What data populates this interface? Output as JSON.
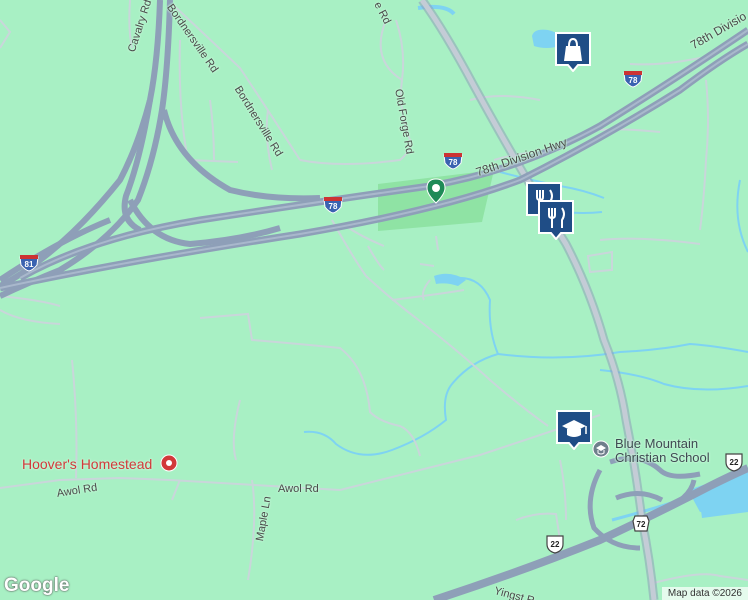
{
  "map": {
    "colors": {
      "land": "#a8f0c4",
      "highway": "#8e9fb8",
      "highway_edge": "#7587a3",
      "minor_road": "#c9d6da",
      "water": "#7ed3f2",
      "park": "#8fe3a4",
      "poi_red": "#d2393a"
    },
    "roads": {
      "cavalry": "Cavalry Rd",
      "bordnersville_top": "Bordnersville Rd",
      "bordnersville_mid": "Bordnersville Rd",
      "old_forge": "Old Forge Rd",
      "road_top_cut": "e Rd",
      "hwy_78th": "78th Division Hwy",
      "hwy_78th_top": "78th Divisio",
      "awol_west": "Awol Rd",
      "awol_east": "Awol Rd",
      "maple": "Maple Ln",
      "yingst": "Yingst R"
    },
    "shields": {
      "i78_a": "78",
      "i78_b": "78",
      "i78_c": "78",
      "i81": "81",
      "us22_a": "22",
      "us22_b": "22",
      "pa72": "72"
    },
    "places": {
      "hoovers": "Hoover's Homestead",
      "school_line1": "Blue Mountain",
      "school_line2": "Christian School"
    },
    "markers": [
      {
        "name": "shopping-marker",
        "icon": "shopping-bag-icon"
      },
      {
        "name": "restaurant-marker-1",
        "icon": "fork-knife-icon"
      },
      {
        "name": "restaurant-marker-2",
        "icon": "fork-knife-icon"
      },
      {
        "name": "school-marker",
        "icon": "graduation-cap-icon"
      }
    ],
    "branding": "Google",
    "copyright": "Map data ©2026"
  }
}
